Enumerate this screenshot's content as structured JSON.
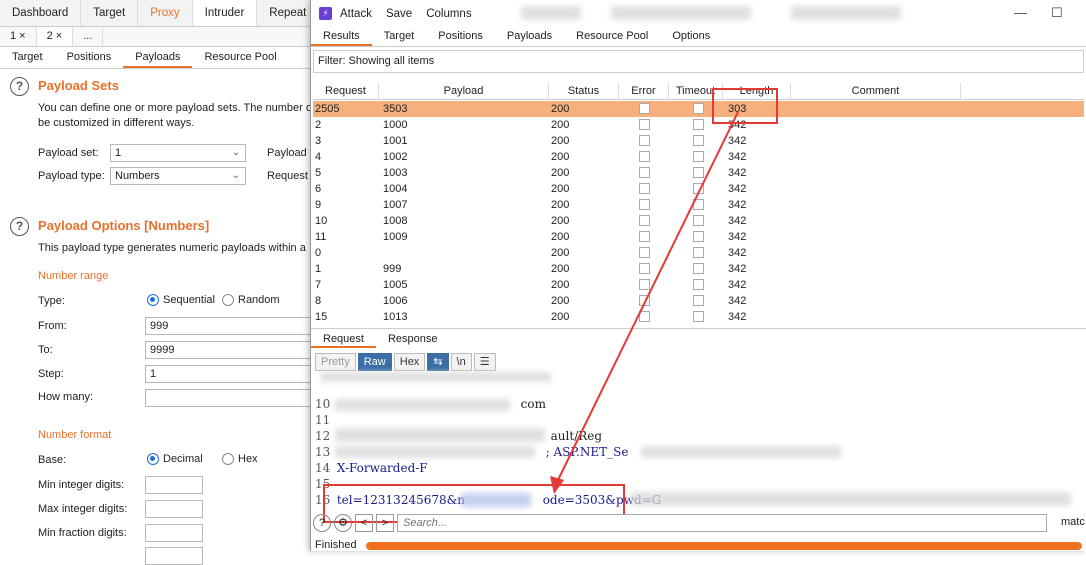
{
  "main": {
    "top_tabs": [
      "Dashboard",
      "Target",
      "Proxy",
      "Intruder",
      "Repeat"
    ],
    "sub_tabs": [
      "1 ×",
      "2 ×",
      "..."
    ],
    "intruder_tabs": [
      "Target",
      "Positions",
      "Payloads",
      "Resource Pool"
    ],
    "payload_sets": {
      "title": "Payload Sets",
      "desc_line1": "You can define one or more payload sets. The number of",
      "desc_line2": "be customized in different ways.",
      "set_label": "Payload set:",
      "set_value": "1",
      "type_label": "Payload type:",
      "type_value": "Numbers",
      "right_label1": "Payload",
      "right_label2": "Request"
    },
    "payload_options": {
      "title": "Payload Options [Numbers]",
      "desc": "This payload type generates numeric payloads within a",
      "number_range": "Number range",
      "type_label": "Type:",
      "type_sequential": "Sequential",
      "type_random": "Random",
      "from_label": "From:",
      "from_value": "999",
      "to_label": "To:",
      "to_value": "9999",
      "step_label": "Step:",
      "step_value": "1",
      "how_many_label": "How many:",
      "number_format": "Number format",
      "base_label": "Base:",
      "base_decimal": "Decimal",
      "base_hex": "Hex",
      "min_int_label": "Min integer digits:",
      "max_int_label": "Max integer digits:",
      "min_frac_label": "Min fraction digits:"
    }
  },
  "attack": {
    "menu": [
      "Attack",
      "Save",
      "Columns"
    ],
    "logo": "⚡",
    "minimize": "—",
    "maximize": "☐",
    "tabs": [
      "Results",
      "Target",
      "Positions",
      "Payloads",
      "Resource Pool",
      "Options"
    ],
    "filter": "Filter: Showing all items",
    "columns": [
      "Request",
      "Payload",
      "Status",
      "Error",
      "Timeout",
      "Length",
      "Comment"
    ],
    "rows": [
      {
        "request": "2505",
        "payload": "3503",
        "status": "200",
        "length": "303"
      },
      {
        "request": "2",
        "payload": "1000",
        "status": "200",
        "length": "342"
      },
      {
        "request": "3",
        "payload": "1001",
        "status": "200",
        "length": "342"
      },
      {
        "request": "4",
        "payload": "1002",
        "status": "200",
        "length": "342"
      },
      {
        "request": "5",
        "payload": "1003",
        "status": "200",
        "length": "342"
      },
      {
        "request": "6",
        "payload": "1004",
        "status": "200",
        "length": "342"
      },
      {
        "request": "9",
        "payload": "1007",
        "status": "200",
        "length": "342"
      },
      {
        "request": "10",
        "payload": "1008",
        "status": "200",
        "length": "342"
      },
      {
        "request": "11",
        "payload": "1009",
        "status": "200",
        "length": "342"
      },
      {
        "request": "0",
        "payload": "",
        "status": "200",
        "length": "342"
      },
      {
        "request": "1",
        "payload": "999",
        "status": "200",
        "length": "342"
      },
      {
        "request": "7",
        "payload": "1005",
        "status": "200",
        "length": "342"
      },
      {
        "request": "8",
        "payload": "1006",
        "status": "200",
        "length": "342"
      },
      {
        "request": "15",
        "payload": "1013",
        "status": "200",
        "length": "342"
      }
    ],
    "req_tabs": [
      "Request",
      "Response"
    ],
    "format_buttons": [
      "Pretty",
      "Raw",
      "Hex",
      "\\n"
    ],
    "code_lines": [
      {
        "num": "10",
        "text": "com"
      },
      {
        "num": "11",
        "text": ""
      },
      {
        "num": "12",
        "text": "ault/Reg"
      },
      {
        "num": "13",
        "text": "; ASP.NET_Se"
      },
      {
        "num": "14",
        "text": "X-Forwarded-F"
      },
      {
        "num": "15",
        "text": ""
      },
      {
        "num": "16",
        "text_a": "tel=12313245678&n",
        "text_b": "ode=3503&pwd=G"
      }
    ],
    "search_placeholder": "Search...",
    "match_label": "matc",
    "status": "Finished",
    "progress": 1.0
  }
}
